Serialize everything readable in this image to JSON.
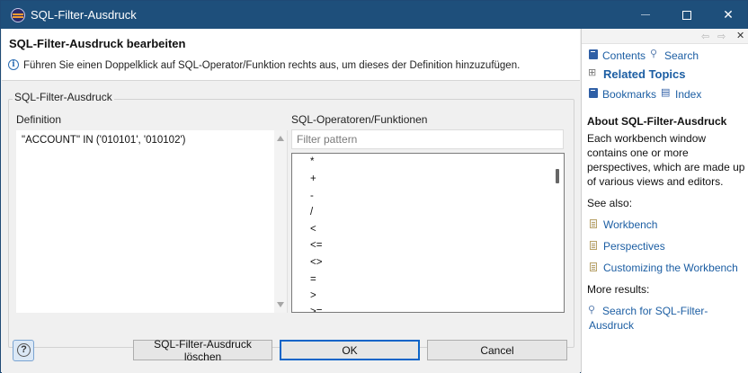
{
  "window": {
    "title": "SQL-Filter-Ausdruck"
  },
  "header": {
    "title": "SQL-Filter-Ausdruck bearbeiten",
    "message": "Führen Sie einen Doppelklick auf SQL-Operator/Funktion rechts aus, um dieses der Definition hinzuzufügen."
  },
  "group": {
    "label": "SQL-Filter-Ausdruck"
  },
  "definition": {
    "label": "Definition",
    "value": "\"ACCOUNT\" IN ('010101', '010102')"
  },
  "operators": {
    "label": "SQL-Operatoren/Funktionen",
    "filter_placeholder": "Filter pattern",
    "items": [
      "*",
      "+",
      "-",
      "/",
      "<",
      "<=",
      "<>",
      "=",
      ">",
      ">="
    ]
  },
  "buttons": {
    "clear": "SQL-Filter-Ausdruck löschen",
    "ok": "OK",
    "cancel": "Cancel"
  },
  "help": {
    "contents": "Contents",
    "search": "Search",
    "related_topics": "Related Topics",
    "bookmarks": "Bookmarks",
    "index": "Index",
    "about_title": "About SQL-Filter-Ausdruck",
    "about_lines": [
      "Each workbench window",
      "contains one or more",
      "perspectives, which are made up",
      "of various views and editors."
    ],
    "see_also": "See also:",
    "links": [
      "Workbench",
      "Perspectives",
      "Customizing the Workbench"
    ],
    "more_results": "More results:",
    "search_result_lines": [
      "Search for SQL-Filter-",
      "Ausdruck"
    ]
  }
}
